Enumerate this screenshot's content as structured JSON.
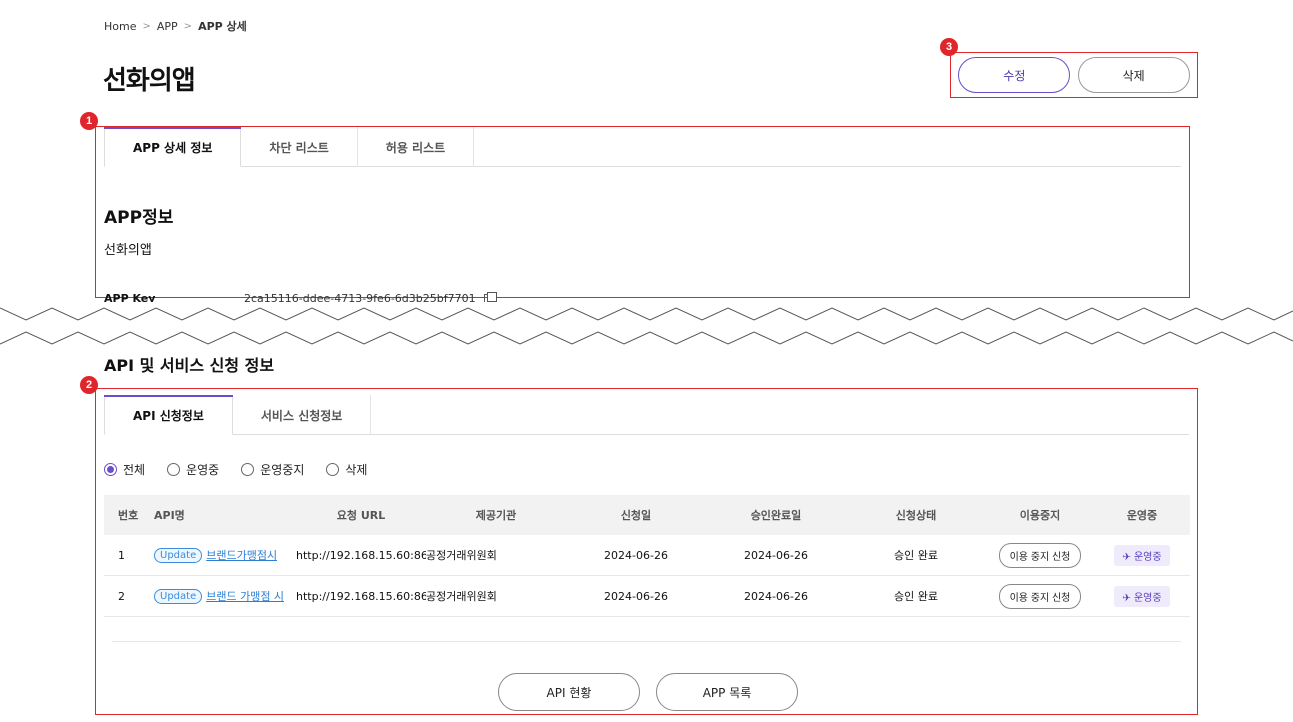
{
  "breadcrumb": {
    "home": "Home",
    "sep": ">",
    "level1": "APP",
    "current": "APP 상세"
  },
  "page": {
    "title": "선화의앱"
  },
  "top_actions": {
    "badge": "3",
    "edit_label": "수정",
    "delete_label": "삭제"
  },
  "app_section": {
    "badge": "1",
    "tabs": [
      {
        "label": "APP 상세 정보",
        "active": true
      },
      {
        "label": "차단 리스트",
        "active": false
      },
      {
        "label": "허용 리스트",
        "active": false
      }
    ],
    "title": "APP정보",
    "app_name": "선화의앱",
    "app_key_label": "APP Key",
    "app_key_value": "2ca15116-ddee-4713-9fe6-6d3b25bf7701"
  },
  "api_section": {
    "title": "API 및 서비스 신청 정보",
    "badge": "2",
    "tabs": [
      {
        "label": "API 신청정보",
        "active": true
      },
      {
        "label": "서비스 신청정보",
        "active": false
      }
    ],
    "filters": [
      {
        "label": "전체",
        "checked": true
      },
      {
        "label": "운영중",
        "checked": false
      },
      {
        "label": "운영중지",
        "checked": false
      },
      {
        "label": "삭제",
        "checked": false
      }
    ],
    "columns": [
      "번호",
      "API명",
      "요청 URL",
      "제공기관",
      "신청일",
      "승인완료일",
      "신청상태",
      "이용중지",
      "운영중"
    ],
    "rows": [
      {
        "no": "1",
        "badge": "Update",
        "api_name": "브랜드가맹점시",
        "url": "http://192.168.15.60:86...",
        "org": "공정거래위원회",
        "applied": "2024-06-26",
        "approved": "2024-06-26",
        "status": "승인 완료",
        "stop": "이용 중지 신청",
        "running": "운영중"
      },
      {
        "no": "2",
        "badge": "Update",
        "api_name": "브랜드 가맹점 시",
        "url": "http://192.168.15.60:86...",
        "org": "공정거래위원회",
        "applied": "2024-06-26",
        "approved": "2024-06-26",
        "status": "승인 완료",
        "stop": "이용 중지 신청",
        "running": "운영중"
      }
    ],
    "api_status_label": "API 현황",
    "app_list_label": "APP 목록"
  },
  "colors": {
    "accent": "#6b4ec9",
    "highlight": "#e0252b",
    "link": "#2b7fd4"
  }
}
